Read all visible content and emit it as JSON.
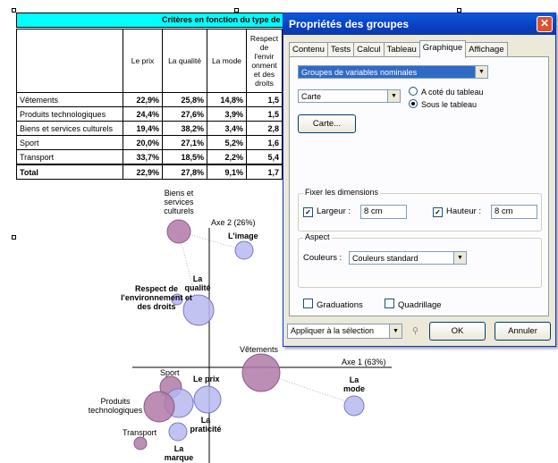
{
  "document": {
    "title_bar": "Critères en fonction du type de",
    "table": {
      "headers": [
        "",
        "Le prix",
        "La qualité",
        "La mode",
        "Respect de l'envir onment et des droits"
      ],
      "rows": [
        {
          "label": "Vêtements",
          "values": [
            "22,9%",
            "25,8%",
            "14,8%",
            "1,5"
          ]
        },
        {
          "label": "Produits technologiques",
          "values": [
            "24,4%",
            "27,6%",
            "3,9%",
            "1,5"
          ]
        },
        {
          "label": "Biens et services culturels",
          "values": [
            "19,4%",
            "38,2%",
            "3,4%",
            "2,8"
          ]
        },
        {
          "label": "Sport",
          "values": [
            "20,0%",
            "27,1%",
            "5,2%",
            "1,6"
          ]
        },
        {
          "label": "Transport",
          "values": [
            "33,7%",
            "18,5%",
            "2,2%",
            "5,4"
          ]
        }
      ],
      "total": {
        "label": "Total",
        "values": [
          "22,9%",
          "27,8%",
          "9,1%",
          "1,7"
        ]
      }
    },
    "map": {
      "axis2_label": "Axe 2 (26%)",
      "axis1_label": "Axe 1 (63%)",
      "labels": {
        "biens": "Biens et services culturels",
        "limage": "L'image",
        "laqualite": "La qualité",
        "respect": "Respect de l'environnement et des droits",
        "vetements": "Vêtements",
        "lamode": "La mode",
        "sport": "Sport",
        "leprix": "Le prix",
        "produits": "Produits technologiques",
        "lapraticite": "La praticité",
        "transport": "Transport",
        "lamarque": "La marque"
      },
      "colors": {
        "variable_bubble": "#b07aa8",
        "criteria_bubble": "#b8b8f0",
        "line": "#000000"
      }
    }
  },
  "dialog": {
    "title": "Propriétés des groupes",
    "close_icon": "close-icon",
    "tabs": [
      "Contenu",
      "Tests",
      "Calcul",
      "Tableau",
      "Graphique",
      "Affichage"
    ],
    "active_tab": "Graphique",
    "group_select": "Groupes de variables nominales",
    "chart_type": "Carte",
    "position_options": [
      "A coté du tableau",
      "Sous le tableau"
    ],
    "position_selected": "Sous le tableau",
    "carte_button": "Carte...",
    "dimensions": {
      "legend": "Fixer les dimensions",
      "width_label": "Largeur :",
      "width_value": "8 cm",
      "height_label": "Hauteur :",
      "height_value": "8 cm"
    },
    "aspect": {
      "legend": "Aspect",
      "colors_label": "Couleurs :",
      "colors_value": "Couleurs standard"
    },
    "graduations_label": "Graduations",
    "quadrillage_label": "Quadrillage",
    "apply_select": "Appliquer à la sélection",
    "ok_label": "OK",
    "cancel_label": "Annuler"
  }
}
